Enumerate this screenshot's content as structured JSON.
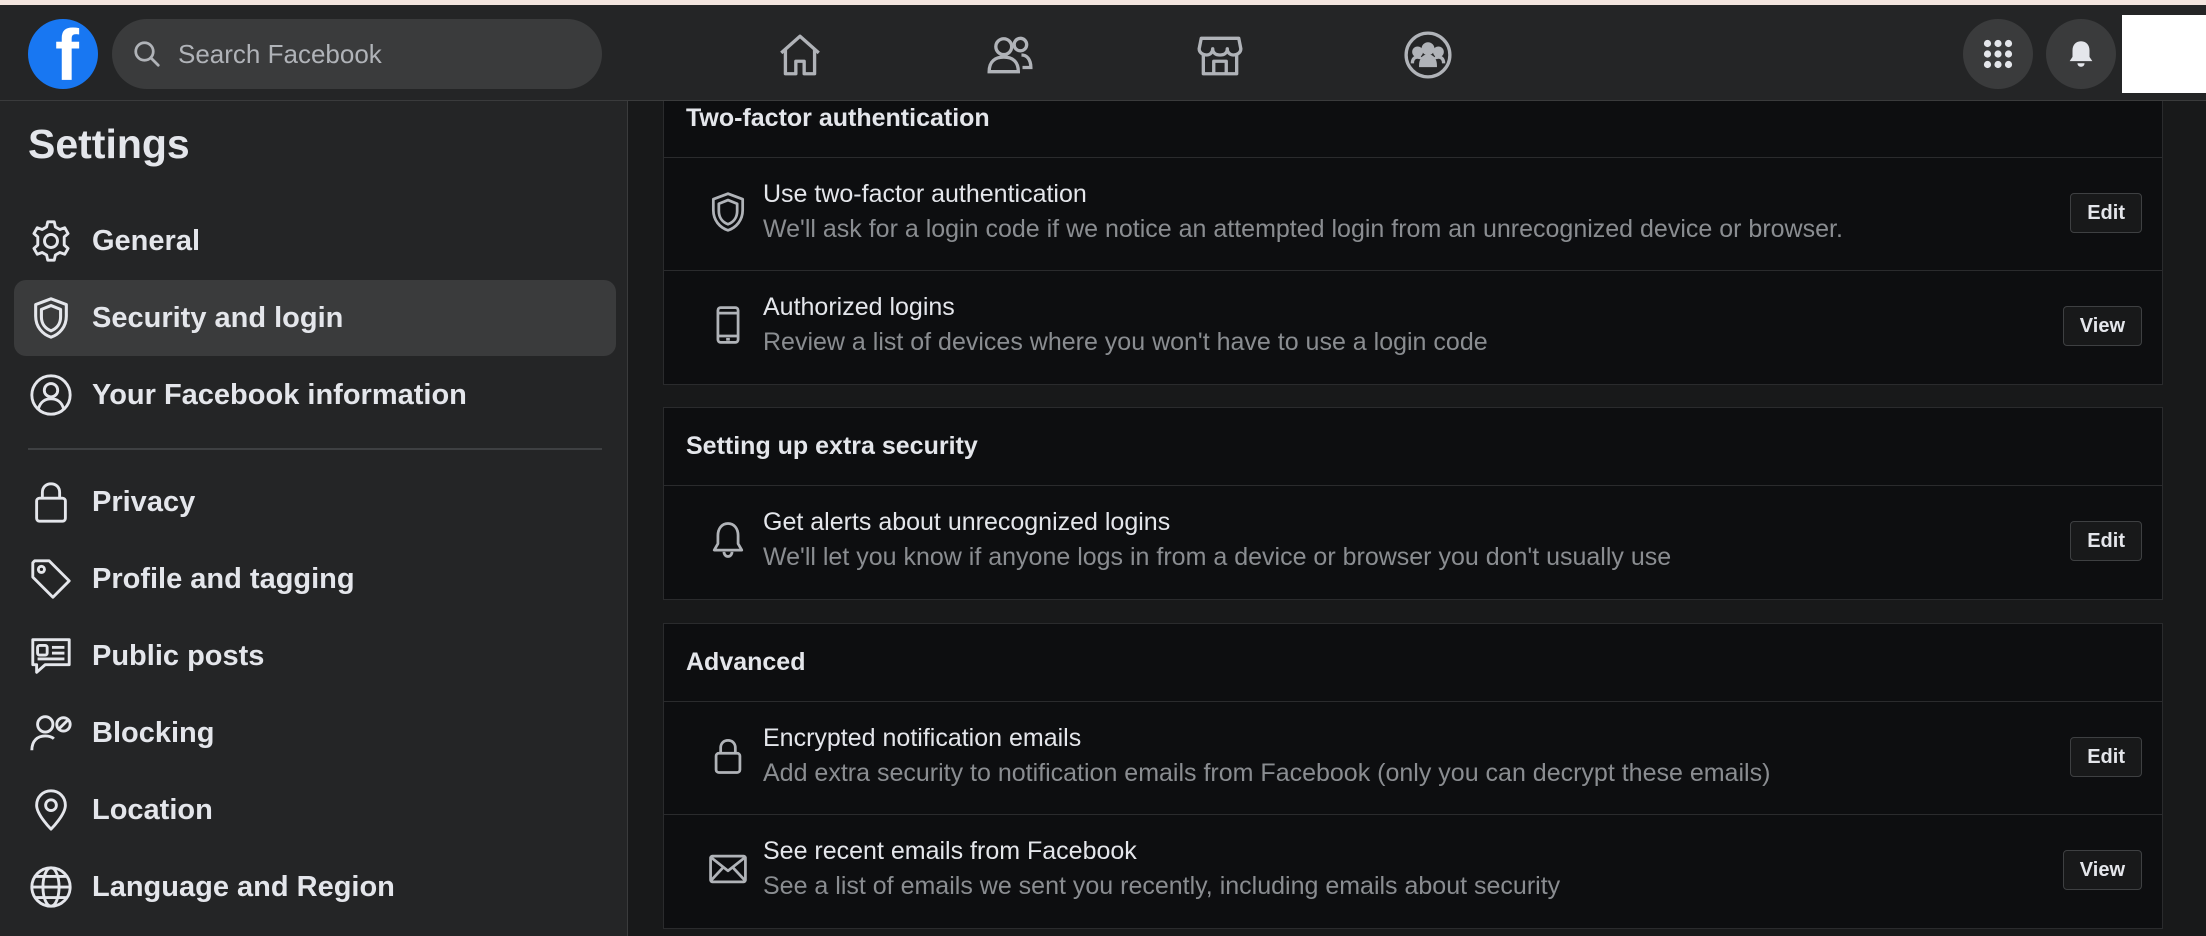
{
  "header": {
    "logo_letter": "f",
    "search_placeholder": "Search Facebook",
    "nav_icons": [
      "home-icon",
      "friends-icon",
      "marketplace-icon",
      "groups-icon"
    ],
    "right_icons": [
      "menu-grid-icon",
      "notifications-bell-icon"
    ]
  },
  "sidebar": {
    "title": "Settings",
    "items": [
      {
        "label": "General",
        "icon": "gear-icon"
      },
      {
        "label": "Security and login",
        "icon": "shield-icon",
        "active": true
      },
      {
        "label": "Your Facebook information",
        "icon": "user-circle-icon"
      },
      {
        "label": "Privacy",
        "icon": "lock-icon"
      },
      {
        "label": "Profile and tagging",
        "icon": "tag-icon"
      },
      {
        "label": "Public posts",
        "icon": "public-posts-icon"
      },
      {
        "label": "Blocking",
        "icon": "blocking-icon"
      },
      {
        "label": "Location",
        "icon": "location-pin-icon"
      },
      {
        "label": "Language and Region",
        "icon": "globe-icon"
      }
    ]
  },
  "sections": [
    {
      "title": "Two-factor authentication",
      "rows": [
        {
          "title": "Use two-factor authentication",
          "subtitle": "We'll ask for a login code if we notice an attempted login from an unrecognized device or browser.",
          "button": "Edit",
          "icon": "shield-icon"
        },
        {
          "title": "Authorized logins",
          "subtitle": "Review a list of devices where you won't have to use a login code",
          "button": "View",
          "icon": "phone-icon"
        }
      ]
    },
    {
      "title": "Setting up extra security",
      "rows": [
        {
          "title": "Get alerts about unrecognized logins",
          "subtitle": "We'll let you know if anyone logs in from a device or browser you don't usually use",
          "button": "Edit",
          "icon": "bell-icon"
        }
      ]
    },
    {
      "title": "Advanced",
      "rows": [
        {
          "title": "Encrypted notification emails",
          "subtitle": "Add extra security to notification emails from Facebook (only you can decrypt these emails)",
          "button": "Edit",
          "icon": "lock-icon"
        },
        {
          "title": "See recent emails from Facebook",
          "subtitle": "See a list of emails we sent you recently, including emails about security",
          "button": "View",
          "icon": "envelope-icon"
        }
      ]
    }
  ],
  "colors": {
    "brand": "#1877f2",
    "background": "#18191a",
    "surface": "#242526",
    "card": "#0d0e10",
    "text_primary": "#e4e6eb",
    "text_secondary": "#8a8d91"
  }
}
